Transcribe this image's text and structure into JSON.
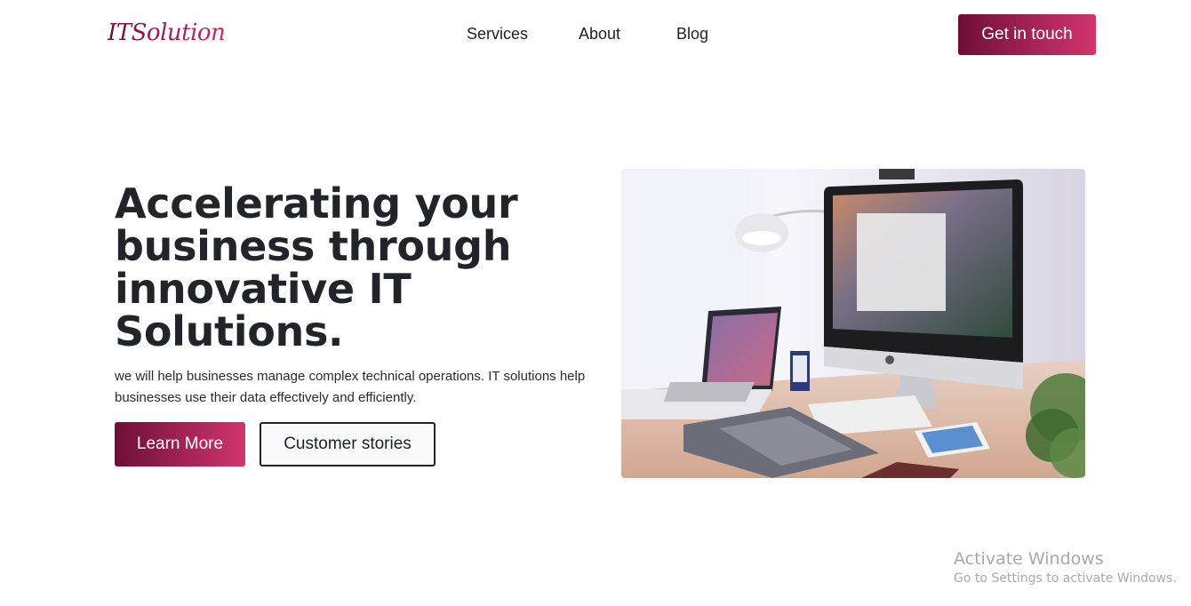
{
  "header": {
    "logo": "ITSolution",
    "nav": [
      "Services",
      "About",
      "Blog"
    ],
    "cta_label": "Get in touch"
  },
  "hero": {
    "title": "Accelerating your business through innovative IT Solutions.",
    "subtitle": "we will help businesses manage complex technical operations. IT solutions help businesses use their data effectively and efficiently.",
    "primary_button": "Learn More",
    "secondary_button": "Customer stories",
    "image_alt": "desk with iMac, laptop, drawing tablet, keyboard and phone"
  },
  "watermark": {
    "title": "Activate Windows",
    "subtitle": "Go to Settings to activate Windows."
  },
  "colors": {
    "accent_dark": "#6e0f38",
    "accent_light": "#d1356d",
    "text": "#212529"
  }
}
